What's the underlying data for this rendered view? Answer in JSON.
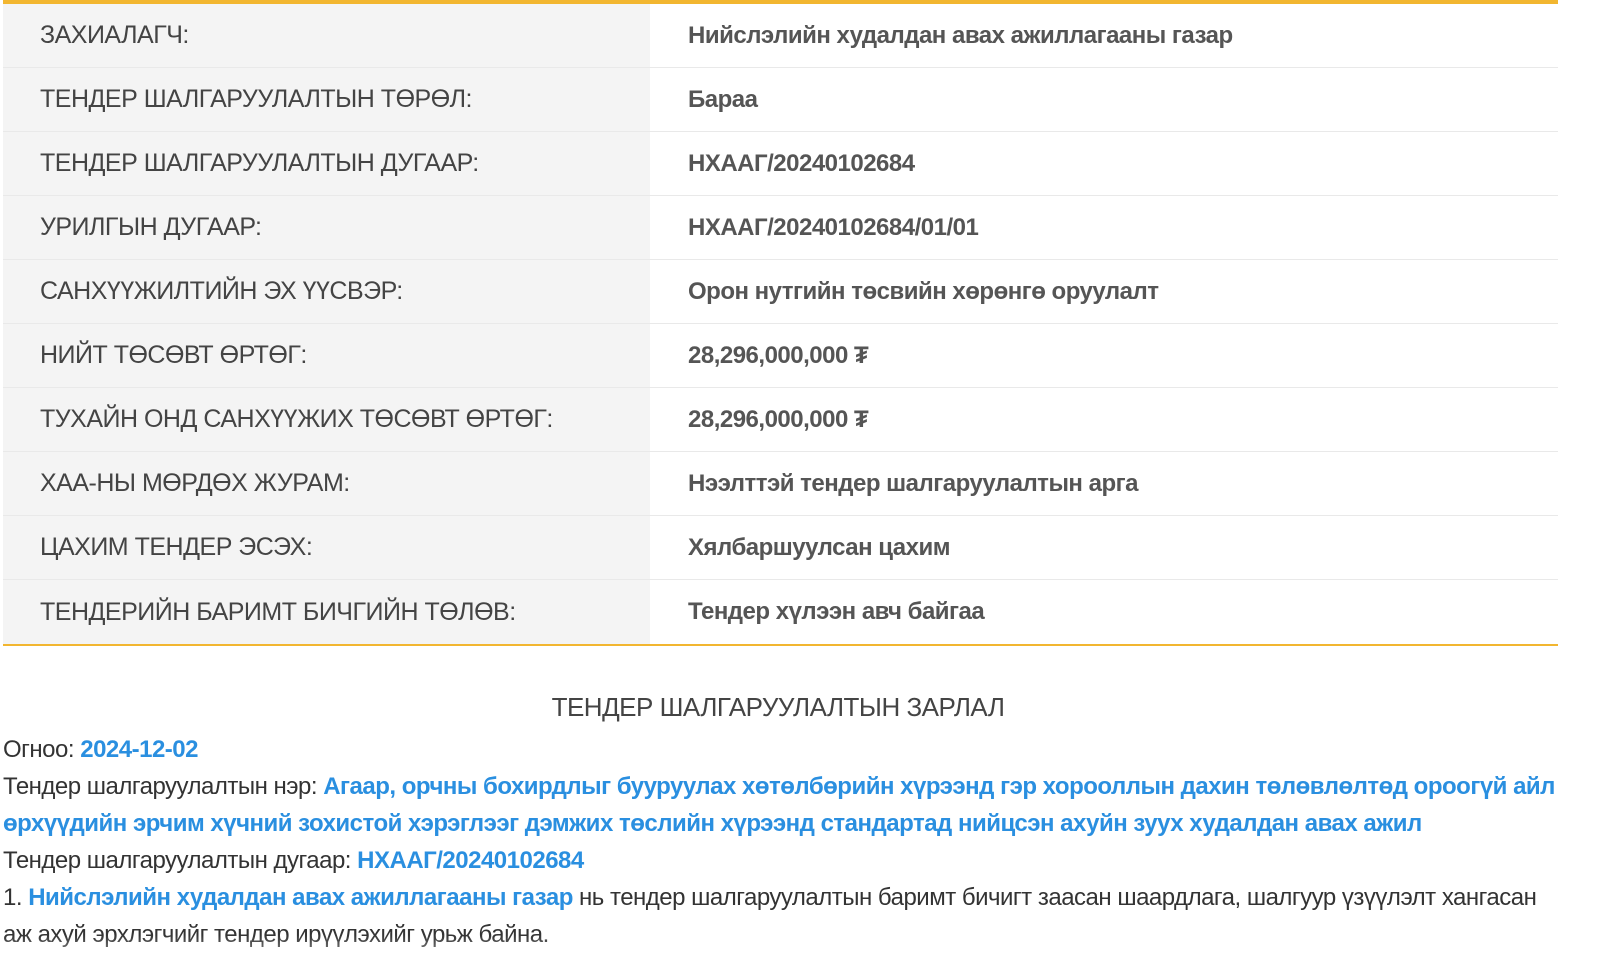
{
  "details": [
    {
      "label": "ЗАХИАЛАГЧ:",
      "value": "Нийслэлийн худалдан авах ажиллагааны газар"
    },
    {
      "label": "ТЕНДЕР ШАЛГАРУУЛАЛТЫН ТӨРӨЛ:",
      "value": "Бараа"
    },
    {
      "label": "ТЕНДЕР ШАЛГАРУУЛАЛТЫН ДУГААР:",
      "value": "НХААГ/20240102684"
    },
    {
      "label": "УРИЛГЫН ДУГААР:",
      "value": "НХААГ/20240102684/01/01"
    },
    {
      "label": "САНХҮҮЖИЛТИЙН ЭХ ҮҮСВЭР:",
      "value": "Орон нутгийн төсвийн хөрөнгө оруулалт"
    },
    {
      "label": "НИЙТ ТӨСӨВТ ӨРТӨГ:",
      "value": "28,296,000,000 ₮"
    },
    {
      "label": "ТУХАЙН ОНД САНХҮҮЖИХ ТӨСӨВТ ӨРТӨГ:",
      "value": "28,296,000,000 ₮"
    },
    {
      "label": "ХАА-НЫ МӨРДӨХ ЖУРАМ:",
      "value": "Нээлттэй тендер шалгаруулалтын арга"
    },
    {
      "label": "ЦАХИМ ТЕНДЕР ЭСЭХ:",
      "value": "Хялбаршуулсан цахим"
    },
    {
      "label": "ТЕНДЕРИЙН БАРИМТ БИЧГИЙН ТӨЛӨВ:",
      "value": "Тендер хүлээн авч байгаа"
    }
  ],
  "announcement": {
    "title": "ТЕНДЕР ШАЛГАРУУЛАЛТЫН ЗАРЛАЛ",
    "date_label": "Огноо: ",
    "date_value": "2024-12-02",
    "name_label": "Тендер шалгаруулалтын нэр: ",
    "name_value": "Агаар, орчны бохирдлыг бууруулах хөтөлбөрийн хүрээнд гэр хорооллын дахин төлөвлөлтөд ороогүй айл өрхүүдийн эрчим хүчний зохистой хэрэглээг дэмжих төслийн хүрээнд стандартад нийцсэн ахуйн зуух худалдан авах ажил",
    "number_label": "Тендер шалгаруулалтын дугаар: ",
    "number_value": "НХААГ/20240102684",
    "item1_prefix": "1. ",
    "item1_link": "Нийслэлийн худалдан авах ажиллагааны газар",
    "item1_text": " нь тендер шалгаруулалтын баримт бичигт заасан шаардлага, шалгуур үзүүлэлт хангасан аж ахуй эрхлэгчийг тендер ирүүлэхийг урьж байна."
  },
  "colors": {
    "accent_border": "#f2b630",
    "link": "#2a8fe0",
    "label_bg": "#f4f4f4"
  }
}
